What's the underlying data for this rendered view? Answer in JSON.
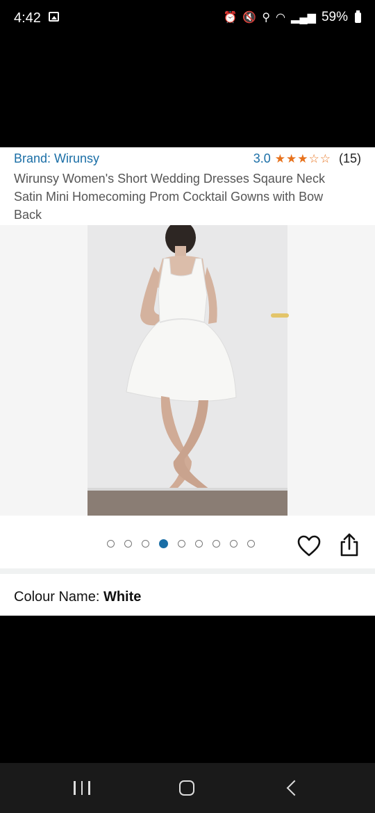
{
  "status_bar": {
    "time": "4:42",
    "battery": "59%",
    "icons": [
      "image-icon",
      "alarm-icon",
      "mute-icon",
      "location-icon",
      "wifi-icon",
      "signal-icon",
      "battery-icon"
    ]
  },
  "product": {
    "brand": "Brand: Wirunsy",
    "rating": "3.0",
    "stars": 3,
    "review_count": "(15)",
    "title": "Wirunsy Women's Short Wedding Dresses Sqaure Neck Satin Mini Homecoming Prom Cocktail Gowns with Bow Back"
  },
  "gallery": {
    "image_count": 9,
    "active_index": 3,
    "accent_color": "#1a6ea6"
  },
  "colour": {
    "label": "Colour Name: ",
    "value": "White"
  },
  "nav": {
    "items": [
      "recent-apps",
      "home",
      "back"
    ]
  }
}
